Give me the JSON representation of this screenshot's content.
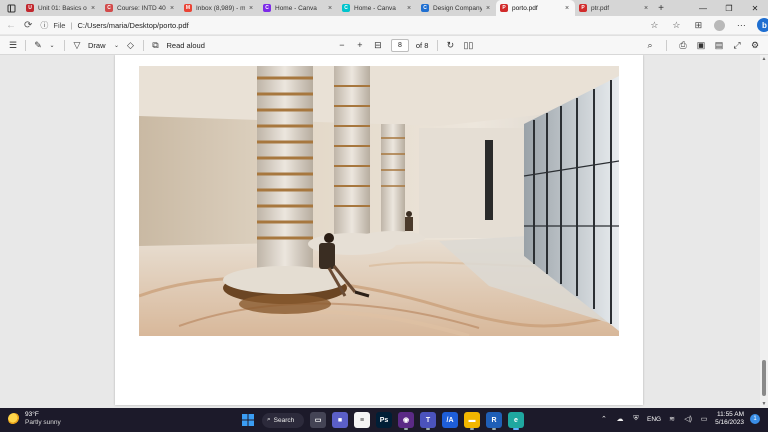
{
  "browser": {
    "tabs": [
      {
        "label": "Unit 01: Basics of",
        "favicon_color": "#c1272d",
        "favicon_glyph": "U"
      },
      {
        "label": "Course: INTD 400",
        "favicon_color": "#d24b4b",
        "favicon_glyph": "C"
      },
      {
        "label": "Inbox (8,989) - m",
        "favicon_color": "#ea4335",
        "favicon_glyph": "M"
      },
      {
        "label": "Home - Canva",
        "favicon_color": "#7d2ae8",
        "favicon_glyph": "C"
      },
      {
        "label": "Home - Canva",
        "favicon_color": "#00c4cc",
        "favicon_glyph": "C"
      },
      {
        "label": "Design Company",
        "favicon_color": "#1f6fd1",
        "favicon_glyph": "C"
      },
      {
        "label": "porto.pdf",
        "favicon_color": "#d12b2b",
        "favicon_glyph": "P",
        "active": true
      },
      {
        "label": "ptr.pdf",
        "favicon_color": "#d12b2b",
        "favicon_glyph": "P"
      }
    ],
    "new_tab_glyph": "+",
    "close_glyph": "×",
    "window_controls": {
      "minimize": "—",
      "restore": "❐",
      "close": "✕"
    },
    "address": {
      "scheme_label": "File",
      "path": "C:/Users/maria/Desktop/porto.pdf"
    },
    "profile_initial": "b"
  },
  "pdf_toolbar": {
    "draw_label": "Draw",
    "read_aloud_label": "Read aloud",
    "zoom_out": "−",
    "zoom_in": "+",
    "page_current": "8",
    "page_total_label": "of 8"
  },
  "document": {
    "page_number": 8,
    "total_pages": 8,
    "scroll_position": 0.92
  },
  "taskbar": {
    "weather": {
      "temp": "93°F",
      "desc": "Partly sunny"
    },
    "search_label": "Search",
    "apps": [
      {
        "name": "windows-start-icon",
        "color": "#3b9df3",
        "glyph": ""
      },
      {
        "name": "search",
        "color": "",
        "glyph": ""
      },
      {
        "name": "task-view-icon",
        "color": "#444455",
        "glyph": "▭"
      },
      {
        "name": "teams-chat-icon",
        "color": "#5b5fc7",
        "glyph": "■"
      },
      {
        "name": "notepad-icon",
        "color": "#f4f4f4",
        "glyph": "≡"
      },
      {
        "name": "photoshop-icon",
        "color": "#001e36",
        "glyph": "Ps"
      },
      {
        "name": "obs-icon",
        "color": "#5b2a86",
        "glyph": "◉"
      },
      {
        "name": "teams-icon",
        "color": "#4b53bc",
        "glyph": "T"
      },
      {
        "name": "premiere-icon",
        "color": "#1e5ed8",
        "glyph": "/A"
      },
      {
        "name": "file-explorer-icon",
        "color": "#f2b600",
        "glyph": "▬"
      },
      {
        "name": "revit-icon",
        "color": "#1f5fb7",
        "glyph": "R"
      },
      {
        "name": "edge-icon",
        "color": "#1fa8a0",
        "glyph": "e"
      }
    ],
    "tray": {
      "language": "ENG",
      "time": "11:55 AM",
      "date": "5/16/2023",
      "notifications": "1"
    }
  }
}
